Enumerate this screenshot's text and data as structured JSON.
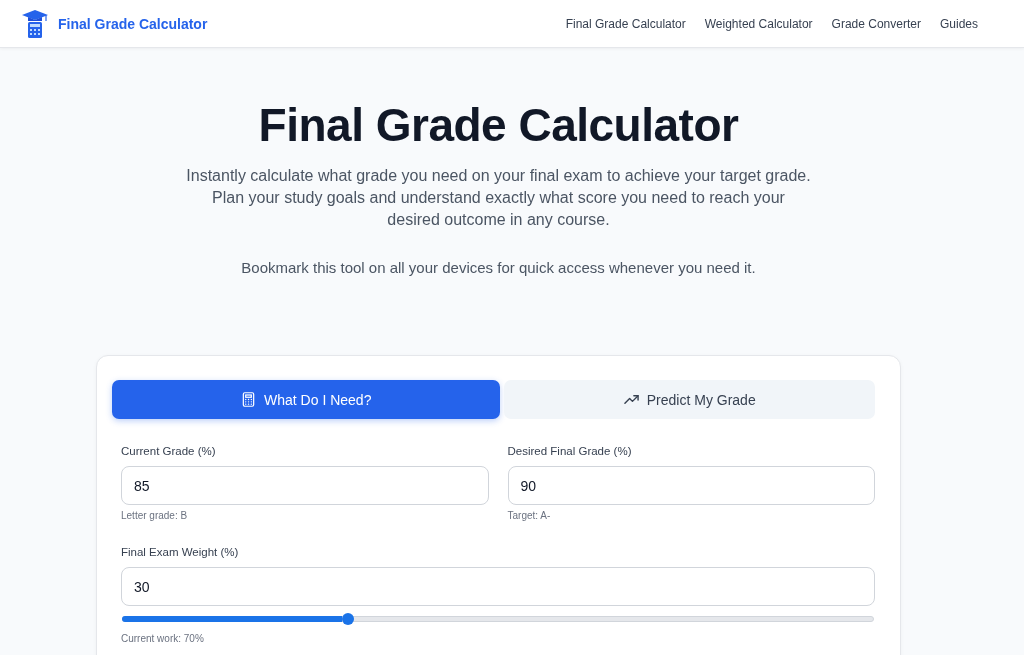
{
  "header": {
    "brand": "Final Grade Calculator",
    "nav": [
      "Final Grade Calculator",
      "Weighted Calculator",
      "Grade Converter",
      "Guides"
    ]
  },
  "hero": {
    "title": "Final Grade Calculator",
    "description": "Instantly calculate what grade you need on your final exam to achieve your target grade. Plan your study goals and understand exactly what score you need to reach your desired outcome in any course.",
    "note": "Bookmark this tool on all your devices for quick access whenever you need it."
  },
  "calculator": {
    "tabs": [
      {
        "label": "What Do I Need?",
        "selected": true
      },
      {
        "label": "Predict My Grade",
        "selected": false
      }
    ],
    "fields": [
      {
        "kind": "input",
        "label": "Current Grade (%)",
        "value": "85",
        "hint": "Letter grade: B"
      },
      {
        "kind": "input",
        "label": "Desired Final Grade (%)",
        "value": "90",
        "hint": "Target: A-"
      },
      {
        "kind": "slider",
        "label": "Final Exam Weight (%)",
        "value": "30",
        "level": 0.3,
        "hint": "Current work: 70%"
      }
    ]
  }
}
